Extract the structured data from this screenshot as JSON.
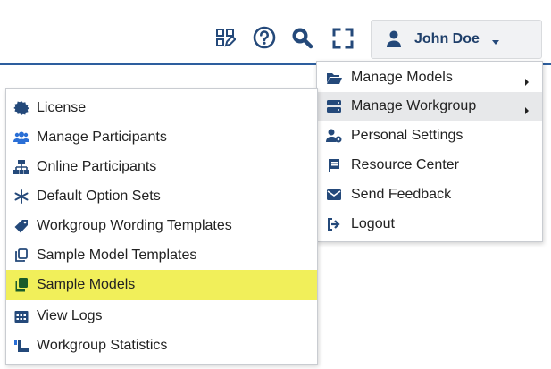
{
  "user": {
    "name": "John Doe"
  },
  "colors": {
    "accent": "#2d5e9e",
    "icon": "#24497a",
    "highlight": "#f1ef5a"
  },
  "toolbar": {
    "icons": [
      "layout-edit-icon",
      "help-icon",
      "search-icon",
      "fullscreen-icon"
    ]
  },
  "main_menu": {
    "items": [
      {
        "label": "Manage Models",
        "icon": "folder-open-icon",
        "has_submenu": true
      },
      {
        "label": "Manage Workgroup",
        "icon": "server-icon",
        "has_submenu": true,
        "active": true
      },
      {
        "label": "Personal Settings",
        "icon": "user-gear-icon",
        "has_submenu": false
      },
      {
        "label": "Resource Center",
        "icon": "book-icon",
        "has_submenu": false
      },
      {
        "label": "Send Feedback",
        "icon": "envelope-icon",
        "has_submenu": false
      },
      {
        "label": "Logout",
        "icon": "sign-out-icon",
        "has_submenu": false
      }
    ]
  },
  "workgroup_menu": {
    "items": [
      {
        "label": "License",
        "icon": "certificate-icon"
      },
      {
        "label": "Manage Participants",
        "icon": "users-icon"
      },
      {
        "label": "Online Participants",
        "icon": "sitemap-icon"
      },
      {
        "label": "Default Option Sets",
        "icon": "asterisk-icon"
      },
      {
        "label": "Workgroup Wording Templates",
        "icon": "tag-icon"
      },
      {
        "label": "Sample Model Templates",
        "icon": "copy-outline-icon"
      },
      {
        "label": "Sample Models",
        "icon": "copy-filled-icon",
        "highlighted": true
      },
      {
        "label": "View Logs",
        "icon": "calendar-icon"
      },
      {
        "label": "Workgroup Statistics",
        "icon": "chart-icon"
      }
    ]
  }
}
